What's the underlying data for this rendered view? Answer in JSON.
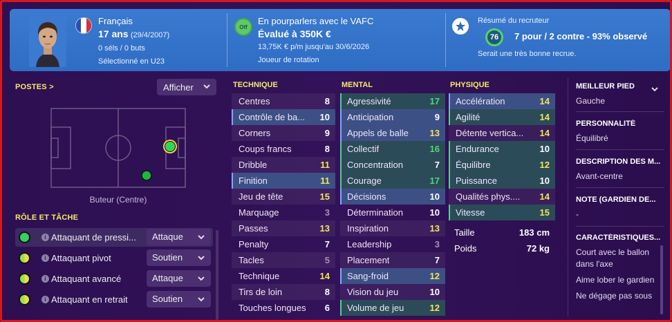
{
  "header": {
    "nationality": "Français",
    "age": "17 ans",
    "birthdate": "(29/4/2007)",
    "caps_goals": "0 séls / 0 buts",
    "selection": "Sélectionné en U23",
    "transfer_status": "En pourparlers avec le VAFC",
    "value": "Évalué à 350K €",
    "contract": "13,75K € p/m jusqu'au 30/6/2026",
    "squad_status": "Joueur de rotation",
    "off_badge": "Off",
    "scout_title": "Résumé du recruteur",
    "scout_rating": "76",
    "scout_summary": "7 pour / 2 contre - 93% observé",
    "scout_note": "Serait une très bonne recrue."
  },
  "positions": {
    "title": "POSTES >",
    "show_label": "Afficher",
    "position_label": "Buteur (Centre)"
  },
  "roles": {
    "title": "RÔLE ET TÂCHE",
    "items": [
      {
        "name": "Attaquant de pressi...",
        "duty": "Attaque",
        "rating": "full"
      },
      {
        "name": "Attaquant pivot",
        "duty": "Soutien",
        "rating": "half"
      },
      {
        "name": "Attaquant avancé",
        "duty": "Attaque",
        "rating": "half"
      },
      {
        "name": "Attaquant en retrait",
        "duty": "Soutien",
        "rating": "half"
      }
    ]
  },
  "technique": {
    "title": "TECHNIQUE",
    "rows": [
      {
        "name": "Centres",
        "value": "8",
        "color": "white",
        "hl": ""
      },
      {
        "name": "Contrôle de ba...",
        "value": "10",
        "color": "white",
        "hl": "blue"
      },
      {
        "name": "Corners",
        "value": "9",
        "color": "white",
        "hl": ""
      },
      {
        "name": "Coups francs",
        "value": "8",
        "color": "white",
        "hl": ""
      },
      {
        "name": "Dribble",
        "value": "11",
        "color": "yellow",
        "hl": ""
      },
      {
        "name": "Finition",
        "value": "11",
        "color": "yellow",
        "hl": "blue"
      },
      {
        "name": "Jeu de tête",
        "value": "15",
        "color": "yellow",
        "hl": ""
      },
      {
        "name": "Marquage",
        "value": "3",
        "color": "grey",
        "hl": ""
      },
      {
        "name": "Passes",
        "value": "13",
        "color": "yellow",
        "hl": ""
      },
      {
        "name": "Penalty",
        "value": "7",
        "color": "white",
        "hl": ""
      },
      {
        "name": "Tacles",
        "value": "5",
        "color": "grey",
        "hl": ""
      },
      {
        "name": "Technique",
        "value": "14",
        "color": "yellow",
        "hl": ""
      },
      {
        "name": "Tirs de loin",
        "value": "8",
        "color": "white",
        "hl": ""
      },
      {
        "name": "Touches longues",
        "value": "6",
        "color": "white",
        "hl": ""
      }
    ]
  },
  "mental": {
    "title": "MENTAL",
    "rows": [
      {
        "name": "Agressivité",
        "value": "17",
        "color": "green",
        "hl": "green"
      },
      {
        "name": "Anticipation",
        "value": "9",
        "color": "white",
        "hl": "blue"
      },
      {
        "name": "Appels de balle",
        "value": "13",
        "color": "yellow",
        "hl": "blue"
      },
      {
        "name": "Collectif",
        "value": "16",
        "color": "green",
        "hl": "green"
      },
      {
        "name": "Concentration",
        "value": "7",
        "color": "white",
        "hl": "green"
      },
      {
        "name": "Courage",
        "value": "17",
        "color": "green",
        "hl": "green"
      },
      {
        "name": "Décisions",
        "value": "10",
        "color": "white",
        "hl": "blue"
      },
      {
        "name": "Détermination",
        "value": "10",
        "color": "white",
        "hl": ""
      },
      {
        "name": "Inspiration",
        "value": "13",
        "color": "yellow",
        "hl": ""
      },
      {
        "name": "Leadership",
        "value": "3",
        "color": "grey",
        "hl": ""
      },
      {
        "name": "Placement",
        "value": "7",
        "color": "white",
        "hl": ""
      },
      {
        "name": "Sang-froid",
        "value": "12",
        "color": "yellow",
        "hl": "blue"
      },
      {
        "name": "Vision du jeu",
        "value": "10",
        "color": "white",
        "hl": ""
      },
      {
        "name": "Volume de jeu",
        "value": "12",
        "color": "yellow",
        "hl": "green"
      }
    ]
  },
  "physique": {
    "title": "PHYSIQUE",
    "rows": [
      {
        "name": "Accélération",
        "value": "14",
        "color": "yellow",
        "hl": "blue"
      },
      {
        "name": "Agilité",
        "value": "14",
        "color": "yellow",
        "hl": "green"
      },
      {
        "name": "Détente vertica...",
        "value": "14",
        "color": "yellow",
        "hl": ""
      },
      {
        "name": "Endurance",
        "value": "10",
        "color": "white",
        "hl": "green"
      },
      {
        "name": "Équilibre",
        "value": "12",
        "color": "yellow",
        "hl": "green"
      },
      {
        "name": "Puissance",
        "value": "10",
        "color": "white",
        "hl": "green"
      },
      {
        "name": "Qualités phys....",
        "value": "14",
        "color": "yellow",
        "hl": ""
      },
      {
        "name": "Vitesse",
        "value": "15",
        "color": "yellow",
        "hl": "green"
      }
    ],
    "height_label": "Taille",
    "height_value": "183 cm",
    "weight_label": "Poids",
    "weight_value": "72 kg"
  },
  "side": {
    "foot_title": "MEILLEUR PIED",
    "foot_value": "Gauche",
    "personality_title": "PERSONNALITÉ",
    "personality_value": "Équilibré",
    "description_title": "DESCRIPTION DES M...",
    "description_value": "Avant-centre",
    "gk_title": "NOTE (GARDIEN DE...",
    "gk_value": "-",
    "traits_title": "CARACTÉRISTIQUES...",
    "traits": [
      "Court avec le ballon dans l'axe",
      "Aime lober le gardien",
      "Ne dégage pas sous"
    ]
  },
  "colors": {
    "header_blue": "#3577cc",
    "background": "#2d0f52",
    "accent_yellow": "#f7e96a",
    "rating_green": "#52d77c",
    "border_red": "#d8161c"
  }
}
